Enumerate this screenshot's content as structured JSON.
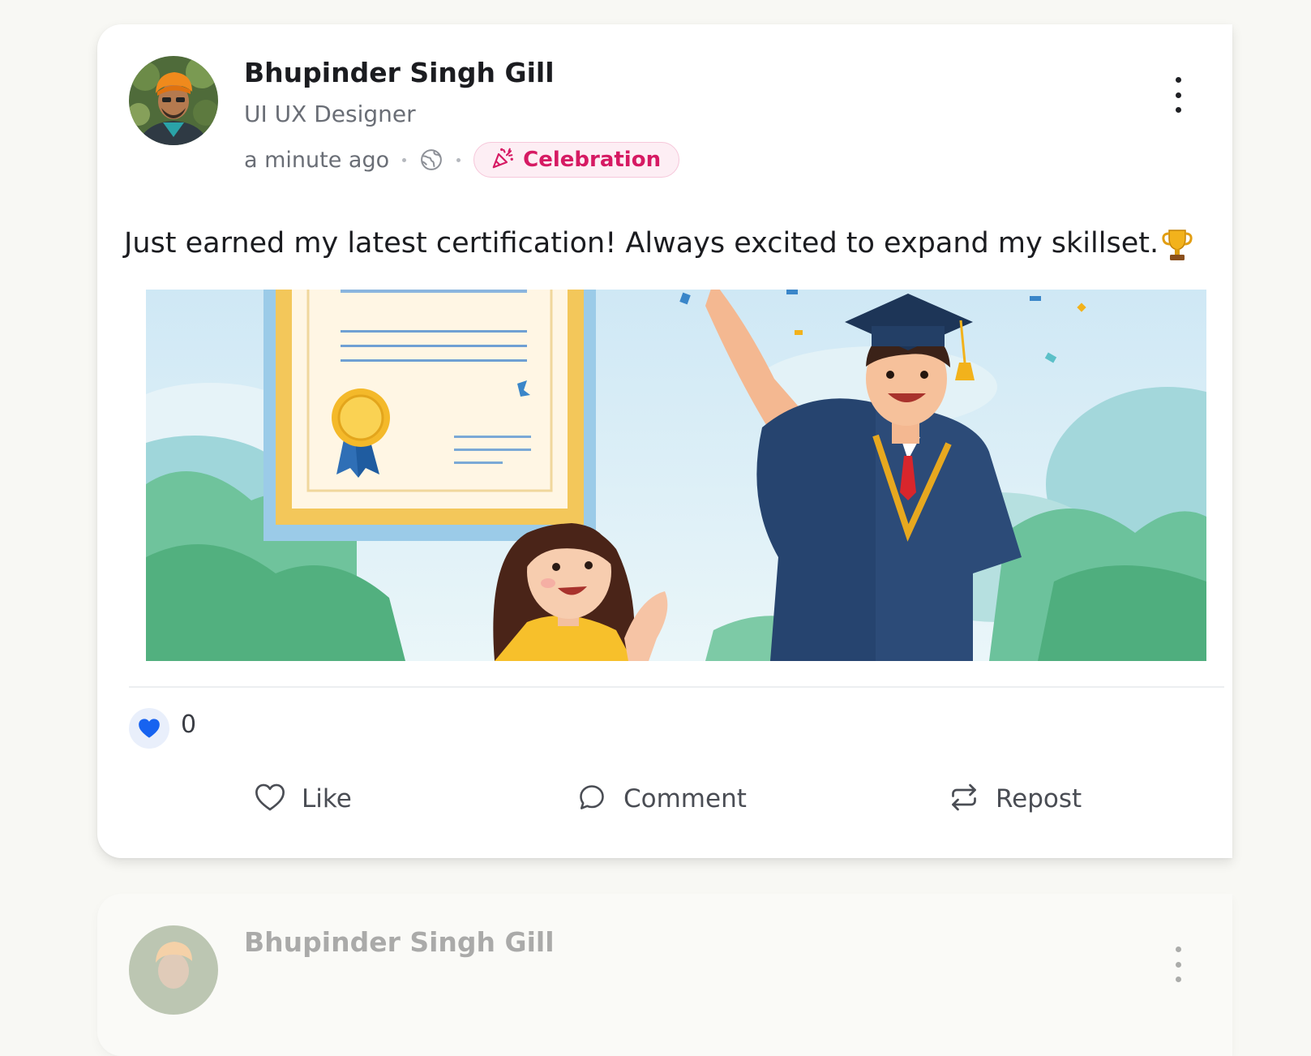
{
  "posts": [
    {
      "author": {
        "name": "Bhupinder Singh Gill",
        "title": "UI UX Designer"
      },
      "meta": {
        "time": "a minute ago",
        "visibility_icon": "globe-icon",
        "category": {
          "label": "Celebration",
          "icon": "party-popper-icon",
          "color": "#d61a63",
          "bg": "#fdeef4"
        }
      },
      "text": "Just earned my latest certification! Always excited to expand my skillset.",
      "text_emoji": "trophy-icon",
      "image": {
        "alt": "Graduate in cap and gown celebrating next to a framed certificate while a girl claps"
      },
      "reactions": {
        "icon": "heart-icon",
        "color": "#1763f0",
        "count": "0"
      },
      "actions": {
        "like_label": "Like",
        "comment_label": "Comment",
        "repost_label": "Repost"
      }
    },
    {
      "author": {
        "name": "Bhupinder Singh Gill"
      }
    }
  ]
}
